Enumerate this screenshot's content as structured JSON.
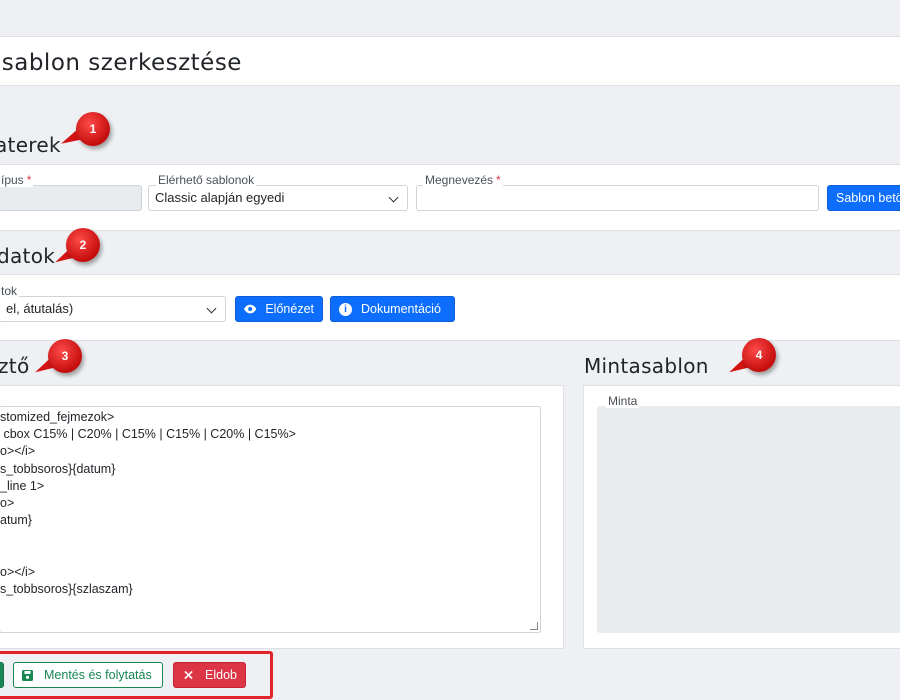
{
  "page": {
    "title": "DF sablon szerkesztése"
  },
  "sections": {
    "parameters": {
      "title": "aterek",
      "marker": "1"
    },
    "data": {
      "title": "datok",
      "marker": "2"
    },
    "editor": {
      "title": "ztő",
      "marker": "3"
    },
    "sample": {
      "title": "Mintasablon",
      "marker": "4"
    }
  },
  "parameters": {
    "type_label": "ípus",
    "templates_label": "Elérhető sablonok",
    "templates_value": "Classic alapján egyedi",
    "name_label": "Megnevezés",
    "name_value": "",
    "load_button": "Sablon betö"
  },
  "data_row": {
    "select_label": "tok",
    "select_value": "el, átutalás)",
    "preview_button": "Előnézet",
    "docs_button": "Dokumentáció"
  },
  "editor": {
    "lines": [
      "stomized_fejmezok>",
      " cbox C15% | C20% | C15% | C15% | C20% | C15%>",
      "o></i>",
      "s_tobbsoros}{datum}",
      "_line 1>",
      "o>",
      "atum}",
      "",
      "",
      "o></i>",
      "s_tobbsoros}{szlaszam}"
    ]
  },
  "sample": {
    "label": "Minta"
  },
  "actions": {
    "save_continue": "Mentés és folytatás",
    "discard": "Eldob"
  },
  "colors": {
    "primary": "#0d6efd",
    "success": "#198754",
    "danger": "#dc3545",
    "marker": "#e3232a"
  }
}
